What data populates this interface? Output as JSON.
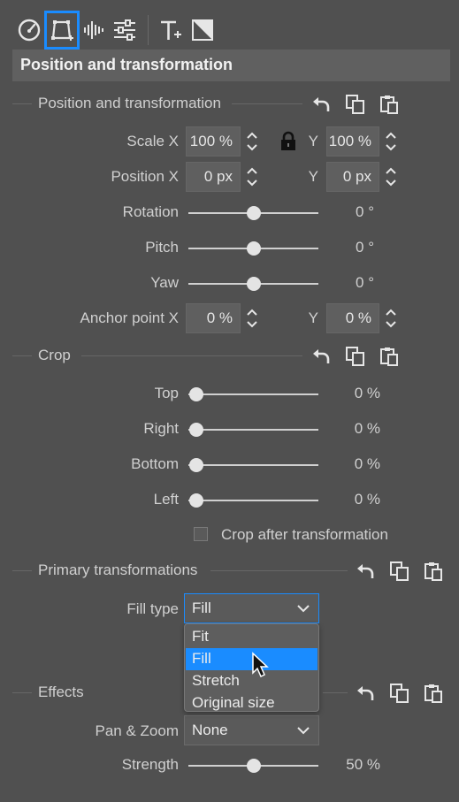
{
  "panel_title": "Position and transformation",
  "toolbar": {
    "icons": [
      "speedometer-icon",
      "transform-icon",
      "audio-waveform-icon",
      "sliders-icon",
      "text-icon",
      "mask-icon"
    ],
    "accent": "#1a8cff"
  },
  "sections": {
    "position": {
      "title": "Position and transformation",
      "scale_x_label": "Scale X",
      "scale_x_value": "100 %",
      "scale_y_label": "Y",
      "scale_y_value": "100 %",
      "position_x_label": "Position X",
      "position_x_value": "0 px",
      "position_y_label": "Y",
      "position_y_value": "0 px",
      "rotation_label": "Rotation",
      "rotation_value": "0 °",
      "pitch_label": "Pitch",
      "pitch_value": "0 °",
      "yaw_label": "Yaw",
      "yaw_value": "0 °",
      "anchor_x_label": "Anchor point X",
      "anchor_x_value": "0 %",
      "anchor_y_label": "Y",
      "anchor_y_value": "0 %"
    },
    "crop": {
      "title": "Crop",
      "top_label": "Top",
      "top_value": "0 %",
      "right_label": "Right",
      "right_value": "0 %",
      "bottom_label": "Bottom",
      "bottom_value": "0 %",
      "left_label": "Left",
      "left_value": "0 %",
      "crop_after_label": "Crop after transformation"
    },
    "primary": {
      "title": "Primary transformations",
      "fill_type_label": "Fill type",
      "fill_type_value": "Fill",
      "options": [
        "Fit",
        "Fill",
        "Stretch",
        "Original size"
      ]
    },
    "effects": {
      "title": "Effects",
      "pan_zoom_label": "Pan & Zoom",
      "pan_zoom_value": "None",
      "strength_label": "Strength",
      "strength_value": "50 %"
    }
  }
}
